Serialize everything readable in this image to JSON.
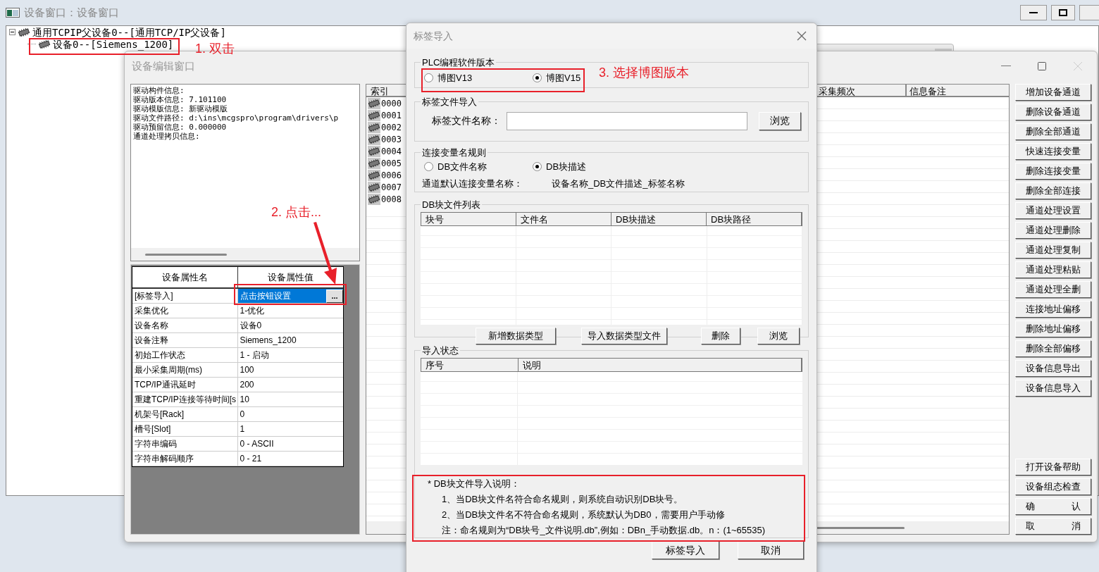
{
  "main_window": {
    "title": "设备窗口：设备窗口",
    "tree": [
      {
        "label": "通用TCPIP父设备0--[通用TCP/IP父设备]",
        "expanded": true,
        "children": [
          {
            "label": "设备0--[Siemens_1200]"
          }
        ]
      }
    ]
  },
  "edit_window": {
    "title": "设备编辑窗口",
    "info_lines": [
      "驱动构件信息:",
      "驱动版本信息: 7.101100",
      "驱动模版信息: 新驱动模版",
      "驱动文件路径: d:\\ins\\mcgspro\\program\\drivers\\p",
      "驱动预留信息: 0.000000",
      "通道处理拷贝信息:"
    ],
    "properties": {
      "columns": [
        "设备属性名",
        "设备属性值"
      ],
      "rows": [
        {
          "name": "[标签导入]",
          "value": "点击按钮设置",
          "selected": true,
          "button": "..."
        },
        {
          "name": "采集优化",
          "value": "1-优化",
          "selected": false
        },
        {
          "name": "设备名称",
          "value": "设备0",
          "selected": false
        },
        {
          "name": "设备注释",
          "value": "Siemens_1200",
          "selected": false
        },
        {
          "name": "初始工作状态",
          "value": "1 - 启动",
          "selected": false
        },
        {
          "name": "最小采集周期(ms)",
          "value": "100",
          "selected": false
        },
        {
          "name": "TCP/IP通讯延时",
          "value": "200",
          "selected": false
        },
        {
          "name": "重建TCP/IP连接等待时间[s",
          "value": "10",
          "selected": false
        },
        {
          "name": "机架号[Rack]",
          "value": "0",
          "selected": false
        },
        {
          "name": "槽号[Slot]",
          "value": "1",
          "selected": false
        },
        {
          "name": "字符串编码",
          "value": "0 - ASCII",
          "selected": false
        },
        {
          "name": "字符串解码顺序",
          "value": "0 - 21",
          "selected": false
        }
      ]
    },
    "channels": {
      "columns": [
        "索引",
        "采集频次",
        "信息备注"
      ],
      "rows": [
        "0000",
        "0001",
        "0002",
        "0003",
        "0004",
        "0005",
        "0006",
        "0007",
        "0008"
      ]
    },
    "side_buttons": [
      "增加设备通道",
      "删除设备通道",
      "删除全部通道",
      "快速连接变量",
      "删除连接变量",
      "删除全部连接",
      "通道处理设置",
      "通道处理删除",
      "通道处理复制",
      "通道处理粘贴",
      "通道处理全删",
      "连接地址偏移",
      "删除地址偏移",
      "删除全部偏移",
      "设备信息导出",
      "设备信息导入"
    ],
    "bottom_buttons": [
      "打开设备帮助",
      "设备组态检查",
      "确　　　　认",
      "取　　　　消"
    ]
  },
  "dialog": {
    "title": "标签导入",
    "version_group": {
      "legend": "PLC编程软件版本",
      "options": [
        {
          "label": "博图V13",
          "selected": false
        },
        {
          "label": "博图V15",
          "selected": true
        }
      ]
    },
    "file_group": {
      "legend": "标签文件导入",
      "label": "标签文件名称：",
      "browse": "浏览"
    },
    "rule_group": {
      "legend": "连接变量名规则",
      "options": [
        {
          "label": "DB文件名称",
          "selected": false
        },
        {
          "label": "DB块描述",
          "selected": true
        }
      ],
      "default_label": "通道默认连接变量名称：",
      "default_value": "设备名称_DB文件描述_标签名称"
    },
    "db_group": {
      "legend": "DB块文件列表",
      "columns": [
        "块号",
        "文件名",
        "DB块描述",
        "DB块路径"
      ],
      "buttons": [
        "新增数据类型",
        "导入数据类型文件",
        "删除",
        "浏览"
      ]
    },
    "status_group": {
      "legend": "导入状态",
      "columns": [
        "序号",
        "说明"
      ]
    },
    "note": [
      "* DB块文件导入说明：",
      "1、当DB块文件名符合命名规则，则系统自动识别DB块号。",
      "2、当DB块文件名不符合命名规则，系统默认为DB0，需要用户手动修",
      "注：命名规则为“DB块号_文件说明.db”,例如：DBn_手动数据.db。n：(1~65535)"
    ],
    "buttons": [
      "标签导入",
      "取消"
    ]
  },
  "annotations": [
    "1. 双击",
    "2. 点击...",
    "3. 选择博图版本"
  ]
}
